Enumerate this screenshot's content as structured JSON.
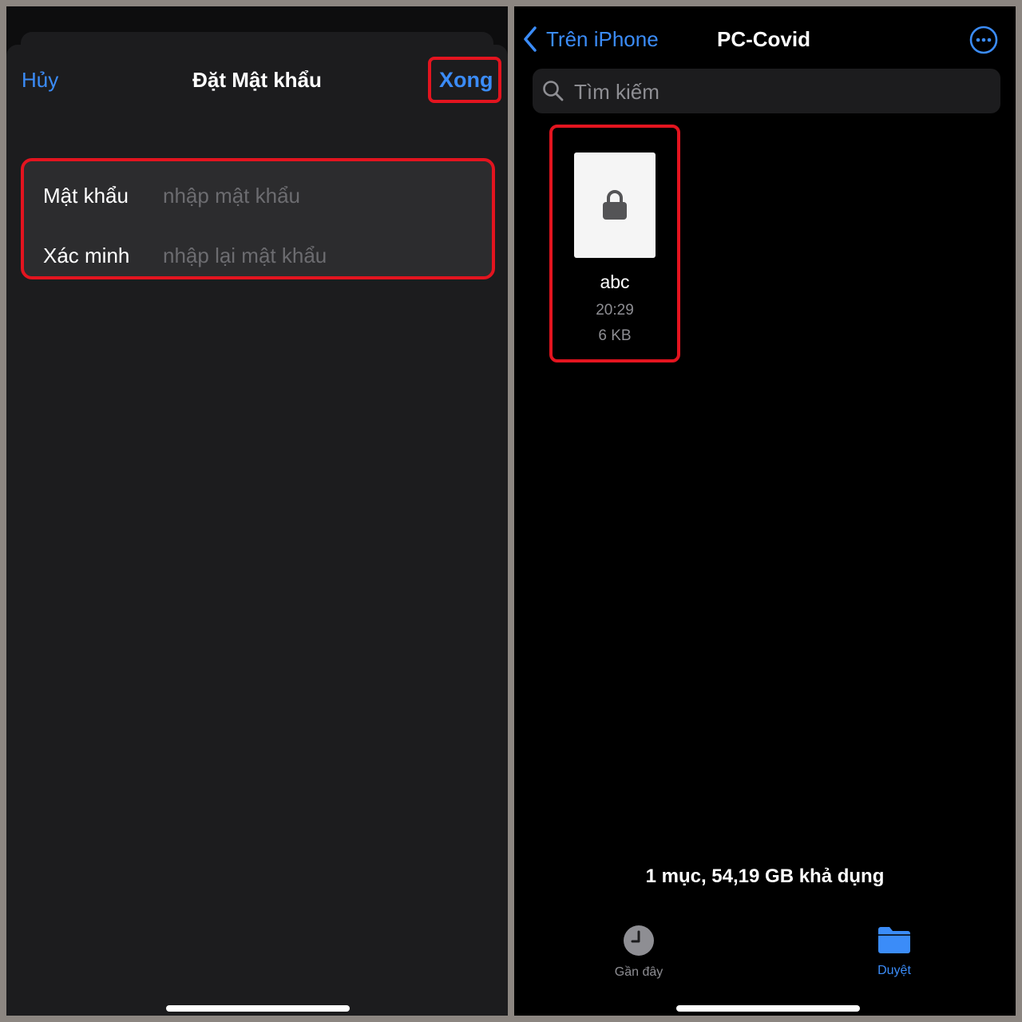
{
  "left_panel": {
    "nav": {
      "cancel_label": "Hủy",
      "title": "Đặt Mật khẩu",
      "done_label": "Xong"
    },
    "form": {
      "password": {
        "label": "Mật khẩu",
        "placeholder": "nhập mật khẩu",
        "value": ""
      },
      "verify": {
        "label": "Xác minh",
        "placeholder": "nhập lại mật khẩu",
        "value": ""
      }
    }
  },
  "right_panel": {
    "nav": {
      "back_label": "Trên iPhone",
      "title": "PC-Covid",
      "more_icon": "ellipsis-circle-icon"
    },
    "search": {
      "placeholder": "Tìm kiếm",
      "icon": "search-icon"
    },
    "files": [
      {
        "name": "abc",
        "time": "20:29",
        "size": "6 KB",
        "icon": "lock-icon"
      }
    ],
    "footer_info": "1 mục, 54,19 GB khả dụng",
    "tabs": [
      {
        "label": "Gần đây",
        "icon": "clock-icon",
        "active": false
      },
      {
        "label": "Duyệt",
        "icon": "folder-icon",
        "active": true
      }
    ]
  },
  "colors": {
    "accent": "#3b8cf8",
    "highlight": "#e3141f",
    "sheet_bg": "#1c1c1e",
    "field_bg": "#2c2c2e"
  }
}
